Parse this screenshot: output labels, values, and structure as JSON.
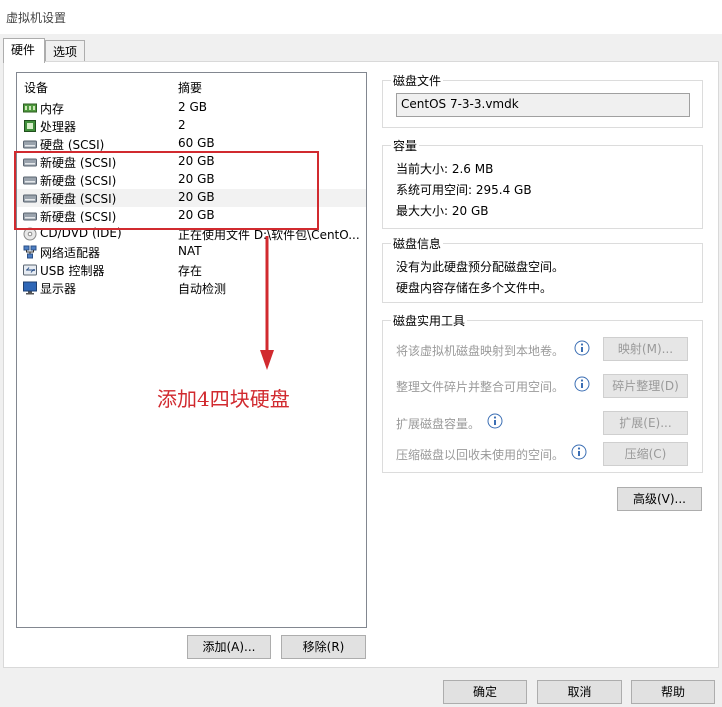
{
  "window": {
    "title": "虚拟机设置"
  },
  "tabs": [
    {
      "label": "硬件"
    },
    {
      "label": "选项"
    }
  ],
  "device_list": {
    "columns": {
      "device": "设备",
      "summary": "摘要"
    },
    "rows": [
      {
        "icon": "memory-icon",
        "device": "内存",
        "summary": "2 GB"
      },
      {
        "icon": "processor-icon",
        "device": "处理器",
        "summary": "2"
      },
      {
        "icon": "hard-disk-icon",
        "device": "硬盘 (SCSI)",
        "summary": "60 GB"
      },
      {
        "icon": "hard-disk-icon",
        "device": "新硬盘 (SCSI)",
        "summary": "20 GB"
      },
      {
        "icon": "hard-disk-icon",
        "device": "新硬盘 (SCSI)",
        "summary": "20 GB"
      },
      {
        "icon": "hard-disk-icon",
        "device": "新硬盘 (SCSI)",
        "summary": "20 GB"
      },
      {
        "icon": "hard-disk-icon",
        "device": "新硬盘 (SCSI)",
        "summary": "20 GB"
      },
      {
        "icon": "cd-dvd-icon",
        "device": "CD/DVD (IDE)",
        "summary": "正在使用文件 D:\\软件包\\CentO..."
      },
      {
        "icon": "network-adapter-icon",
        "device": "网络适配器",
        "summary": "NAT"
      },
      {
        "icon": "usb-icon",
        "device": "USB 控制器",
        "summary": "存在"
      },
      {
        "icon": "display-icon",
        "device": "显示器",
        "summary": "自动检测"
      }
    ],
    "add_label": "添加(A)...",
    "remove_label": "移除(R)"
  },
  "annotation": {
    "text": "添加4四块硬盘",
    "color": "#d12a2f"
  },
  "disk_file": {
    "title": "磁盘文件",
    "value": "CentOS 7-3-3.vmdk"
  },
  "capacity": {
    "title": "容量",
    "current": "当前大小: 2.6 MB",
    "available": "系统可用空间: 295.4 GB",
    "max": "最大大小: 20 GB"
  },
  "disk_info": {
    "title": "磁盘信息",
    "line1": "没有为此硬盘预分配磁盘空间。",
    "line2": "硬盘内容存储在多个文件中。"
  },
  "utilities": {
    "title": "磁盘实用工具",
    "map_desc": "将该虚拟机磁盘映射到本地卷。",
    "map_btn": "映射(M)...",
    "defrag_desc": "整理文件碎片并整合可用空间。",
    "defrag_btn": "碎片整理(D)",
    "expand_desc": "扩展磁盘容量。",
    "expand_btn": "扩展(E)...",
    "compact_desc": "压缩磁盘以回收未使用的空间。",
    "compact_btn": "压缩(C)"
  },
  "advanced_btn": "高级(V)...",
  "footer": {
    "ok": "确定",
    "cancel": "取消",
    "help": "帮助"
  }
}
